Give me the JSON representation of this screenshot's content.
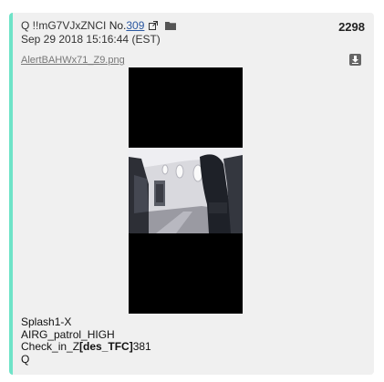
{
  "post": {
    "author": "Q !!mG7VJxZNCI",
    "number_label": "No.",
    "number": "309",
    "timestamp": "Sep 29 2018 15:16:44 (EST)",
    "count": "2298",
    "attachment": {
      "filename": "AlertBAHWx71_Z9.png",
      "image_description_icon": "airplane-cabin-photo"
    },
    "body": {
      "line1": "Splash1-X",
      "line2": "AIRG_patrol_HIGH",
      "line3_prefix": "Check_in_Z",
      "line3_bold": "[des_TFC]",
      "line3_suffix": "381",
      "line4": "Q"
    }
  },
  "icons": {
    "external_link": "external-link-icon",
    "folder": "folder-icon",
    "download": "download-icon"
  },
  "colors": {
    "card_background": "#f0f0f0",
    "accent_border": "#6fe3c8",
    "link": "#2a57a0"
  }
}
